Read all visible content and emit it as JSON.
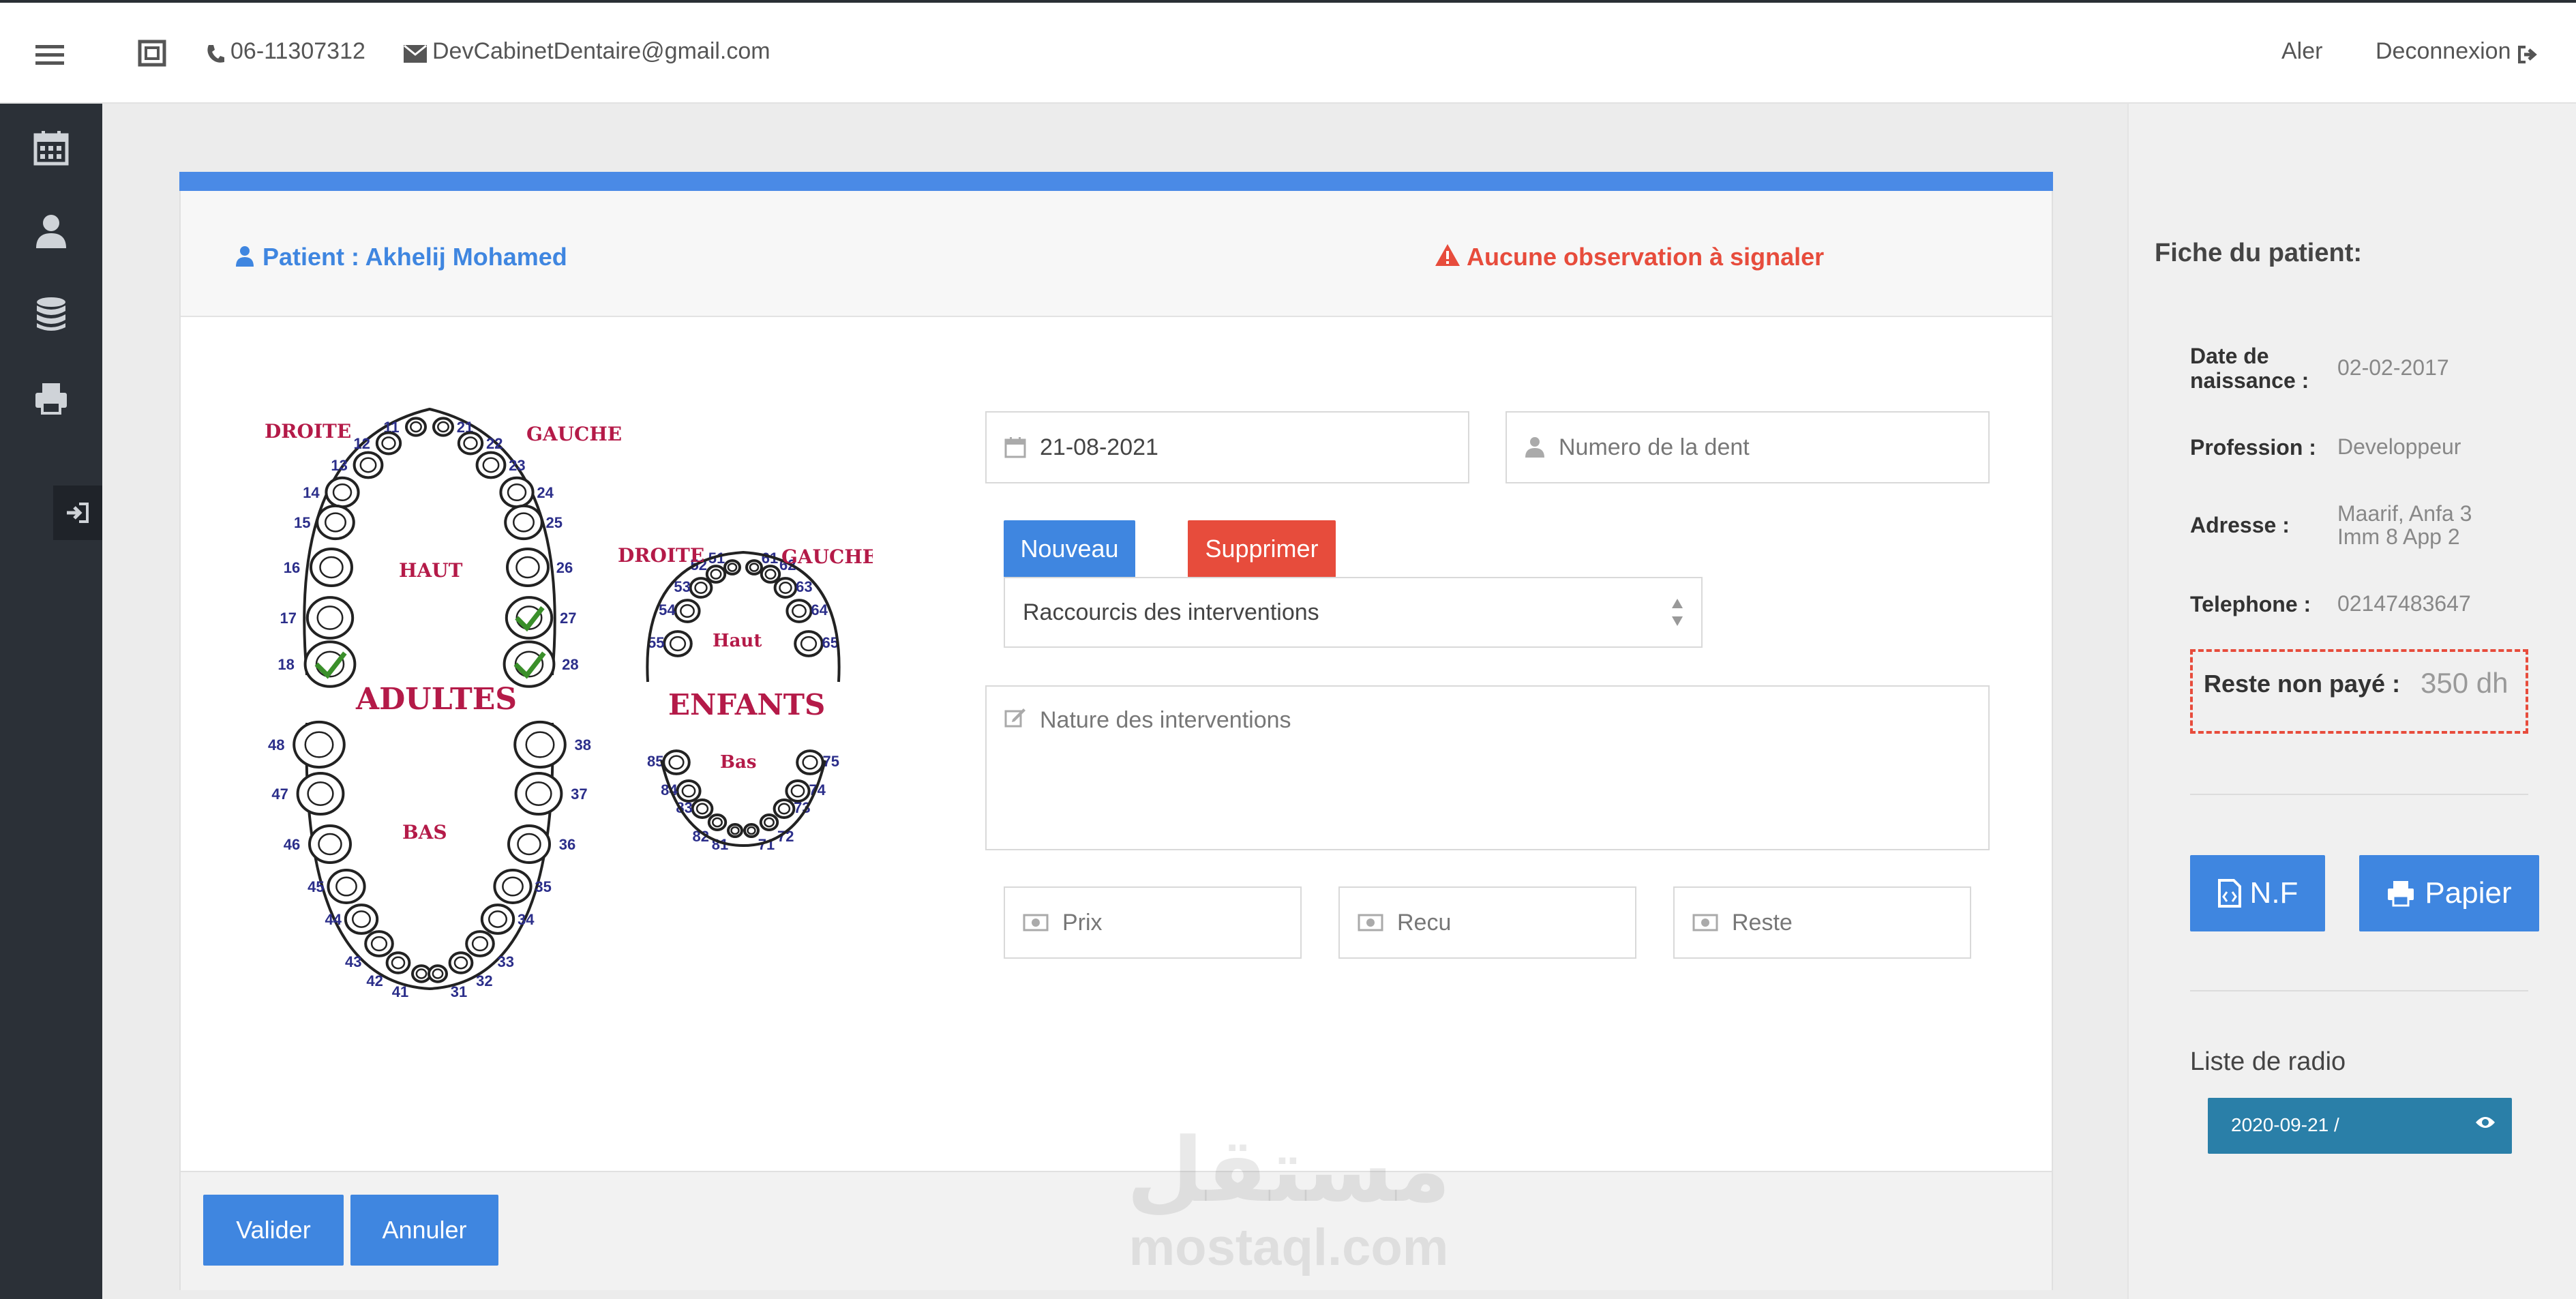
{
  "topbar": {
    "phone": "06-11307312",
    "email": "DevCabinetDentaire@gmail.com",
    "alert_label": "Aler",
    "logout_label": "Deconnexion"
  },
  "header": {
    "patient": "Patient : Akhelij Mohamed",
    "observation": "Aucune observation à signaler"
  },
  "chart": {
    "adult_labels": {
      "left": "DROITE",
      "right": "GAUCHE",
      "top": "HAUT",
      "title": "ADULTES",
      "bottom": "BAS"
    },
    "child_labels": {
      "left": "DROITE",
      "right": "GAUCHE",
      "top": "Haut",
      "title": "ENFANTS",
      "bottom": "Bas"
    },
    "adult_teeth_upper": [
      "11",
      "12",
      "13",
      "14",
      "15",
      "16",
      "17",
      "18",
      "21",
      "22",
      "23",
      "24",
      "25",
      "26",
      "27",
      "28"
    ],
    "adult_teeth_lower": [
      "31",
      "32",
      "33",
      "34",
      "35",
      "36",
      "37",
      "38",
      "41",
      "42",
      "43",
      "44",
      "45",
      "46",
      "47",
      "48"
    ],
    "child_teeth_upper": [
      "51",
      "52",
      "53",
      "54",
      "55",
      "61",
      "62",
      "63",
      "64",
      "65"
    ],
    "child_teeth_lower": [
      "71",
      "72",
      "73",
      "74",
      "75",
      "81",
      "82",
      "83",
      "84",
      "85"
    ],
    "checked_teeth": [
      "18",
      "27",
      "28"
    ]
  },
  "form": {
    "date": "21-08-2021",
    "tooth_placeholder": "Numero de la dent",
    "new_label": "Nouveau",
    "delete_label": "Supprimer",
    "shortcuts_label": "Raccourcis des interventions",
    "nature_placeholder": "Nature des interventions",
    "price_placeholder": "Prix",
    "received_placeholder": "Recu",
    "remaining_placeholder": "Reste",
    "validate_label": "Valider",
    "cancel_label": "Annuler"
  },
  "patient_sheet": {
    "title": "Fiche du patient:",
    "birth_label": "Date de naissance :",
    "birth_value": "02-02-2017",
    "profession_label": "Profession :",
    "profession_value": "Developpeur",
    "address_label": "Adresse :",
    "address_value": "Maarif, Anfa 3 Imm 8 App 2",
    "phone_label": "Telephone :",
    "phone_value": "02147483647",
    "unpaid_label": "Reste non payé :",
    "unpaid_value": "350 dh",
    "nf_label": "N.F",
    "paper_label": "Papier",
    "radio_title": "Liste de radio",
    "radio_item": "2020-09-21 /"
  },
  "watermark": {
    "arabic": "مستقل",
    "latin": "mostaql.com"
  },
  "colors": {
    "primary": "#3f86e0",
    "danger": "#e74c3c",
    "sidebar": "#2b3037",
    "tooth_label": "#b41a48",
    "tooth_number": "#2b2e8a",
    "check": "#3a8f2a"
  }
}
